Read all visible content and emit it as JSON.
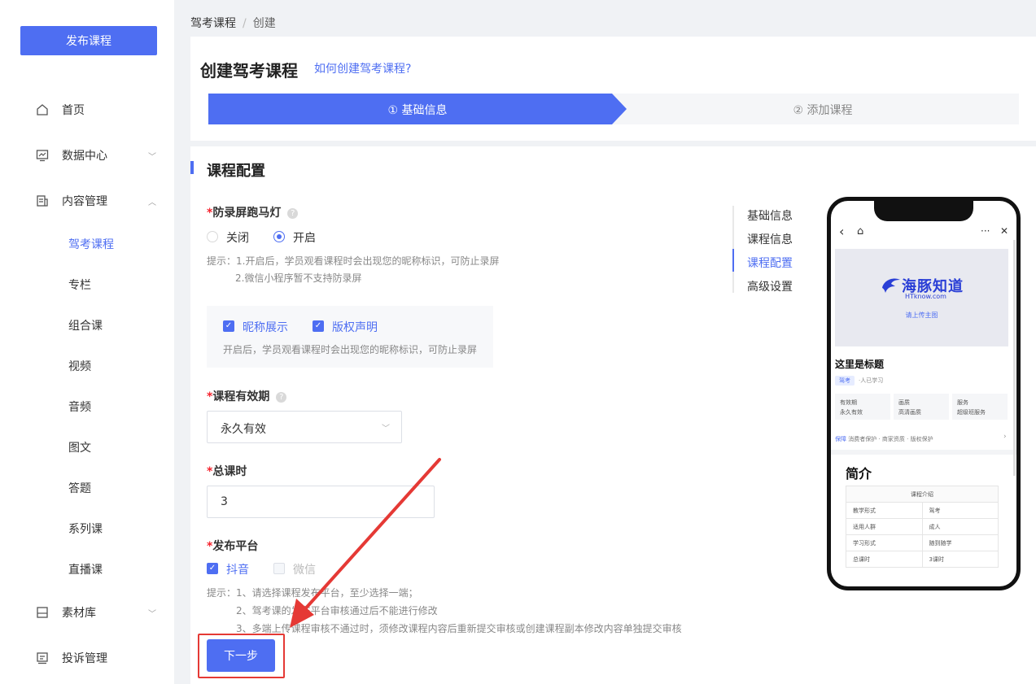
{
  "sidebar": {
    "publish_button": "发布课程",
    "nav": [
      {
        "label": "首页"
      },
      {
        "label": "数据中心"
      },
      {
        "label": "内容管理"
      }
    ],
    "content_sub": [
      "驾考课程",
      "专栏",
      "组合课",
      "视频",
      "音频",
      "图文",
      "答题",
      "系列课",
      "直播课"
    ],
    "nav_bottom": [
      {
        "label": "素材库"
      },
      {
        "label": "投诉管理"
      }
    ]
  },
  "breadcrumb": {
    "parent": "驾考课程",
    "separator": "/",
    "current": "创建"
  },
  "header": {
    "title": "创建驾考课程",
    "help_link": "如何创建驾考课程?",
    "steps": [
      {
        "label": "① 基础信息",
        "active": true
      },
      {
        "label": "② 添加课程",
        "active": false
      }
    ]
  },
  "form": {
    "section_title": "课程配置",
    "marquee": {
      "required_mark": "*",
      "label": "防录屏跑马灯",
      "help": "?",
      "options": [
        "关闭",
        "开启"
      ],
      "selected": "开启",
      "hint_line1": "提示：1.开启后，学员观看课程时会出现您的昵称标识，可防止录屏",
      "hint_line2": "2.微信小程序暂不支持防录屏"
    },
    "marquee_box": {
      "nickname_label": "昵称展示",
      "copyright_label": "版权声明",
      "check": "✓",
      "hint": "开启后，学员观看课程时会出现您的昵称标识，可防止录屏"
    },
    "validity": {
      "required_mark": "*",
      "label": "课程有效期",
      "help": "?",
      "value": "永久有效"
    },
    "total_lessons": {
      "required_mark": "*",
      "label": "总课时",
      "value": "3"
    },
    "platform": {
      "required_mark": "*",
      "label": "发布平台",
      "options": [
        {
          "label": "抖音",
          "checked": true
        },
        {
          "label": "微信",
          "checked": false
        }
      ],
      "hint_line1": "提示：1、请选择课程发布平台，至少选择一端；",
      "hint_line2": "2、驾考课的发布平台审核通过后不能进行修改",
      "hint_line3": "3、多端上传课程审核不通过时，须修改课程内容后重新提交审核或创建课程副本修改内容单独提交审核"
    },
    "next_button": "下一步"
  },
  "anchors": [
    "基础信息",
    "课程信息",
    "课程配置",
    "高级设置"
  ],
  "anchor_active": "课程配置",
  "phone_preview": {
    "back_icon": "‹",
    "home_icon": "⌂",
    "more_icon": "···",
    "close_icon": "✕",
    "logo_text": "海豚知道",
    "logo_sub": "HTknow.com",
    "upload_tip": "请上传主图",
    "title": "这里是标题",
    "tag": "驾考",
    "learners": "·人已学习",
    "cells": [
      {
        "label": "有效期",
        "value": "永久有效"
      },
      {
        "label": "画质",
        "value": "高清画质"
      },
      {
        "label": "服务",
        "value": "超级班服务"
      }
    ],
    "guarantee_label": "保障",
    "guarantee_text": "消费者保护 · 商家资质 · 版权保护",
    "intro_title": "简介",
    "table_header": "课程介绍",
    "table_rows": [
      [
        "教学形式",
        "驾考"
      ],
      [
        "适用人群",
        "成人"
      ],
      [
        "学习形式",
        "随到随学"
      ],
      [
        "总课时",
        "3课时"
      ]
    ]
  },
  "colors": {
    "accent": "#4e6ef2",
    "annotation": "#e53935"
  }
}
